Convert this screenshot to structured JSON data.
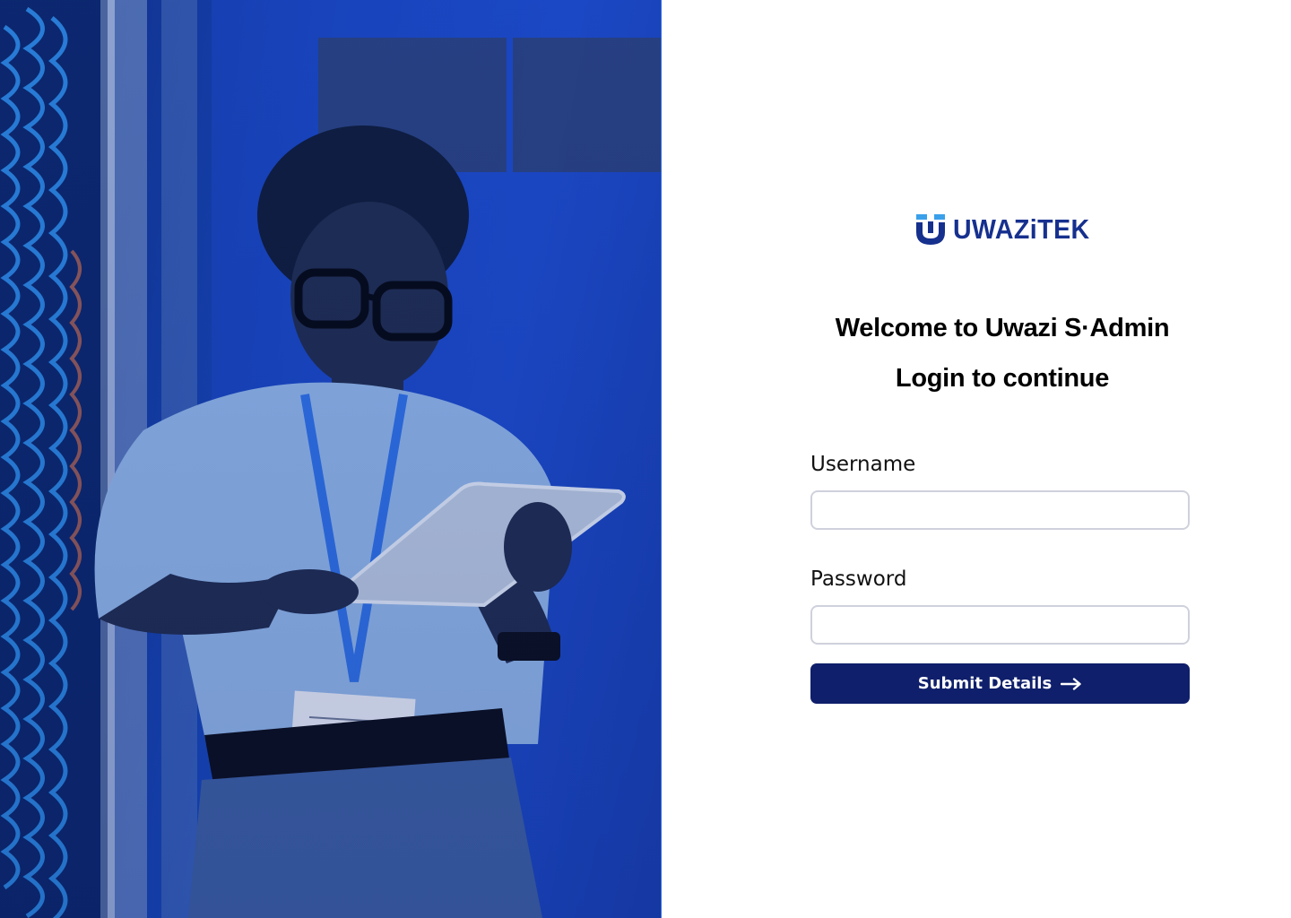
{
  "brand": {
    "logo_text": "UWAZiTEK",
    "logo_icon": "uwazitek-u-icon",
    "color": "#16308e"
  },
  "hero": {
    "image": "technician-with-tablet-in-server-room-photo"
  },
  "login": {
    "welcome": "Welcome to Uwazi S·Admin",
    "subtitle": "Login to continue",
    "username_label": "Username",
    "username_value": "",
    "password_label": "Password",
    "password_value": "",
    "submit_label": "Submit Details",
    "submit_icon": "arrow-right-icon",
    "submit_color": "#0f1f6b"
  }
}
